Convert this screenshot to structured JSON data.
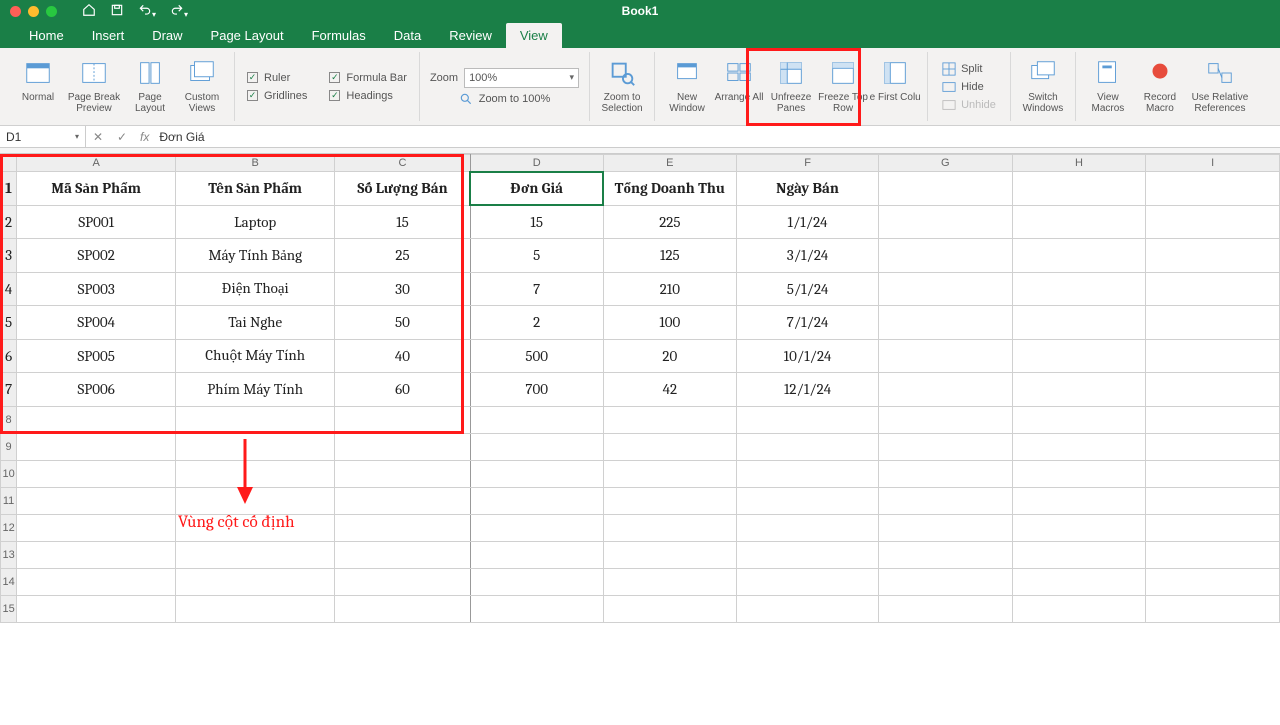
{
  "title": "Book1",
  "tabs": [
    "Home",
    "Insert",
    "Draw",
    "Page Layout",
    "Formulas",
    "Data",
    "Review",
    "View"
  ],
  "active_tab": "View",
  "ribbon": {
    "views": {
      "normal": "Normal",
      "page_break": "Page Break Preview",
      "page_layout": "Page Layout",
      "custom": "Custom Views"
    },
    "checks": {
      "ruler": "Ruler",
      "formula_bar": "Formula Bar",
      "gridlines": "Gridlines",
      "headings": "Headings"
    },
    "zoom": {
      "label": "Zoom",
      "value": "100%",
      "to_100": "Zoom to 100%",
      "to_sel": "Zoom to Selection"
    },
    "window": {
      "new": "New Window",
      "arrange": "Arrange All",
      "unfreeze": "Unfreeze Panes",
      "freeze_top": "Freeze Top Row",
      "freeze_first": "Freeze First Column",
      "split": "Split",
      "hide": "Hide",
      "unhide": "Unhide",
      "switch": "Switch Windows"
    },
    "macros": {
      "view": "View Macros",
      "record": "Record Macro",
      "use_rel": "Use Relative References"
    }
  },
  "namebox": "D1",
  "formula_value": "Đơn Giá",
  "columns": [
    "A",
    "B",
    "C",
    "D",
    "E",
    "F",
    "G",
    "H",
    "I"
  ],
  "header_row": [
    "Mã Sản Phẩm",
    "Tên Sản Phẩm",
    "Số Lượng Bán",
    "Đơn Giá",
    "Tổng Doanh Thu",
    "Ngày Bán",
    "",
    "",
    ""
  ],
  "data_rows": [
    [
      "SP001",
      "Laptop",
      "15",
      "15",
      "225",
      "1/1/24",
      "",
      "",
      ""
    ],
    [
      "SP002",
      "Máy Tính Bảng",
      "25",
      "5",
      "125",
      "3/1/24",
      "",
      "",
      ""
    ],
    [
      "SP003",
      "Điện Thoại",
      "30",
      "7",
      "210",
      "5/1/24",
      "",
      "",
      ""
    ],
    [
      "SP004",
      "Tai Nghe",
      "50",
      "2",
      "100",
      "7/1/24",
      "",
      "",
      ""
    ],
    [
      "SP005",
      "Chuột Máy Tính",
      "40",
      "500",
      "20",
      "10/1/24",
      "",
      "",
      ""
    ],
    [
      "SP006",
      "Phím Máy Tính",
      "60",
      "700",
      "42",
      "12/1/24",
      "",
      "",
      ""
    ]
  ],
  "row_numbers": [
    "1",
    "2",
    "3",
    "4",
    "5",
    "6",
    "7",
    "8",
    "9",
    "10",
    "11",
    "12",
    "13",
    "14",
    "15"
  ],
  "annotation": "Vùng cột cố định",
  "selected_cell": "D1"
}
